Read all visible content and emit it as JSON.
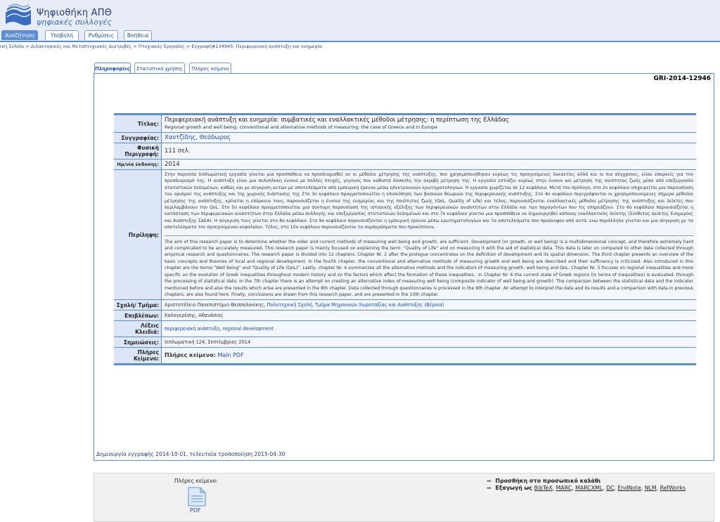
{
  "header": {
    "title": "Ψηφιοθήκη ΑΠΘ",
    "subtitle": "ψηφιακές συλλογές",
    "nav": [
      "Αναζήτηση",
      "Υποβολή",
      "Ρυθμίσεις",
      "Βοήθεια"
    ]
  },
  "breadcrumb": "ική Σελίδα > Διδακτορικές και Μεταπτυχιακές Διατριβές > Πτυχιακές Εργασίες > Εγγραφή#134945: Περιφερειακή ανάπτυξη και ευημερία",
  "record_tabs": [
    "Πληροφορίες",
    "Στατιστικά χρήσης",
    "Πλήρες κείμενο"
  ],
  "record_code": "GRI-2014-12946",
  "labels": {
    "title": "Τίτλος:",
    "authors": "Συγγραφέας:",
    "physical": "Φυσική Περιγραφή:",
    "date": "Ημ/νία έκδοσης:",
    "abstract": "Περίληψη:",
    "school": "Σχολή/ Τμήμα:",
    "supervisor": "Επιβλέπων:",
    "keywords": "Λέξεις Κλειδιά:",
    "notes": "Σημειώσεις:",
    "fulltext": "Πλήρες Κείμενο:"
  },
  "record": {
    "title_el": "Περιφερειακή ανάπτυξη και ευημερία: συμβατικές και εναλλακτικές μέθοδοι μέτρησης: η περίπτωση της Ελλάδας",
    "title_en": "Regional growth and well being: conventional and alternative methods of measuring: the case of Greece and in Europe",
    "author": "Χαντζίδης, Θεόδωρος",
    "physical": "111 σελ.",
    "date": "2014",
    "abstract_el": "Στην παρούσα διπλωματική εργασία γίνεται μια προσπάθεια να προσδιορισθεί αν οι μέθοδοι μέτρησης της ανάπτυξης, που χρησιμοποιήθηκαν ευρέως τις προηγούμενες δεκαετίες αλλά και οι πιο σύγχρονες, είναι επαρκείς για τον προσδιορισμό της. Η ανάπτυξη είναι μια πολυπλοκη έννοια με πολλές πτυχές, γεγονός που καθιστά δύσκολη την ακριβή μέτρηση της. Η εργασία εστιάζει κυρίως στην έννοια και μέτρηση της ποιότητας ζωής μέσα από επεξεργασία στατιστικών δεδομένων, καθώς και με σύγκριση αυτών με αποτελέσματα από εμπειρική έρευνα μέσω ηλεκτρονικών ερωτηματολογίων. Η εργασία χωρίζεται σε 12 κεφάλαια. Μετά τον πρόλογο, στο 2ο κεφάλαιο επιχειρείται μια παρουσίαση του ορισμού της ανάπτυξης και της χωρικής διάστασης της Στο 3ο κεφάλαιο πραγματοποιείται η επισκόπηση των βασικών θεωριών της περιφερειακής ανάπτυξης. Στο 4ο κεφάλαιο περιγράφονται οι χρησιμοποιούμενες σήμερα μέθοδοι μέτρησης της ανάπτυξης, κρίνεται η επάρκεια τους, παρουσιάζεται η έννοια της ευημερίας και της ποιότητας ζωής (QoL, Quality of Life) και τέλος, παρουσιάζονται εναλλακτικές μέθοδοι μέτρησης της ανάπτυξης και δείκτες που περιλαμβάνουν την QoL. Στο 5ο κεφάλαιο πραγματοποιείται μια σύντομη παρουσίαση της ιστορικής εξέλιξης των περιφερειακών ανισοτήτων στην Ελλάδα και των παραγόντων που τις επηρεάζουν. Στο 6ο κεφάλαιο παρουσιάζεται η κατάσταση των περιφερειακών ανισοτήτων στην Ελλάδα μέσω συλλογής και επεξεργασίας στατιστικών δεδομένων και στο 7ο κεφάλαιο γίνεται μια προσπάθεια να δημιουργηθεί κάποιος εναλλακτικός δείκτης (Σύνθετος Δείκτης Ευημερίας και Ανάπτυξης ΣΔΕΑ). Η σύγκριση τους γίνεται στο 8ο κεφάλαιο. Στο 9ο κεφάλαιο παρουσιάζονται η εμπειρική έρευνα μέσω ερωτηματολογίων και τα αποτελέσματα που προέκυψαν από αυτά, ενώ παράλληλα γίνεται και μια σύγκριση με τα αποτελέσματα του προηγούμενου κεφαλαίου. Τέλος, στο 10ο κεφάλαιο παρουσιάζονται τα συμπεράσματα που προκύπτουν.",
    "abstract_en": "The aim of this research paper is to determine whether the older and current methods of measuring well being and growth, are sufficient. Development (or growth, or well being) is a multidimensional concept, and therefore extremely hard and complicated to be accurately measured. This research paper is mainly focused on explaining the term: \"Quality of Life\" and on measuring it with the aid of statistical data. This data is later on compared to other data collected through empirical research and questionnaires. The research paper is divided into 12 chapters. Chapter Nr. 2 after the prologue concentrates on the definition of development and its spatial dimension. The third chapter presents an overview of the basic concepts and theories of local and regional development. In the fourth chapter, the conventional and alternative methods of measuring growth and well being are described and their sufficiency is criticized. Also introduced in this chapter are the terms \"Well being\" and \"Quality of Life (QoL)\". Lastly, chapter Nr. 4 summarizes all the alternative methods and the indicators of measuring growth, well being and QoL. Chapter Nr. 5 focuses on regional inequalities and more specific on the evolution of Greek inequalities throughout modern history and on the factors which affect the formation of these inequalities.. In Chapter Nr. 6 the current state of Greek regions (in terms of inequalities) is evaluated, through the processing of statistical data. In the 7th chapter there is an attempt on creating an alternative index of measuring well being (composite indicator of well being and growth). The comparison between the statistical data and the indicator mentioned before and also the results which arise are presented in the 8th chapter. Data collected through questionnaires is processed in the 9th chapter. An attempt to interpret the data and its results and a comparison with data in previous chapters, are also found here. Finally, conclusions are drawn from this research paper, and are presented in the 10th chapter.",
    "school_plain": "Αριστοτέλειο Πανεπιστήμιο Θεσσαλονίκης, ",
    "school_link": "Πολυτεχνική Σχολή, Τμήμα Μηχανικών Χωροταξίας και Ανάπτυξης (Βέροια)",
    "supervisor": "Καλογερέσης, Αθανάσιος",
    "keywords": "περιφερειακή ανάπτυξη, regional development",
    "notes": "διπλωματική 124, Σεπτέμβριος 2014",
    "fulltext_label": "Πλήρες κείμενο: ",
    "fulltext_link": "Main PDF"
  },
  "footer": "Δημιουργία εγγραφής 2014-10-01, τελευταία τροποποίηση 2015-04-30",
  "bottom": {
    "fulltext_label": "Πλήρες κείμενο:",
    "pdf_label": "PDF",
    "add_basket": "Προσθήκη στο προσωπικό καλάθι",
    "export_label": "Εξαγωγή ως ",
    "export_formats": [
      "BibTeX",
      "MARC",
      "MARCXML",
      "DC",
      "EndNote",
      "NLM",
      "RefWorks"
    ]
  },
  "colors": {
    "accent": "#5b8ed6",
    "link": "#1e4ea8",
    "header_bg": "#e7ecf6"
  }
}
